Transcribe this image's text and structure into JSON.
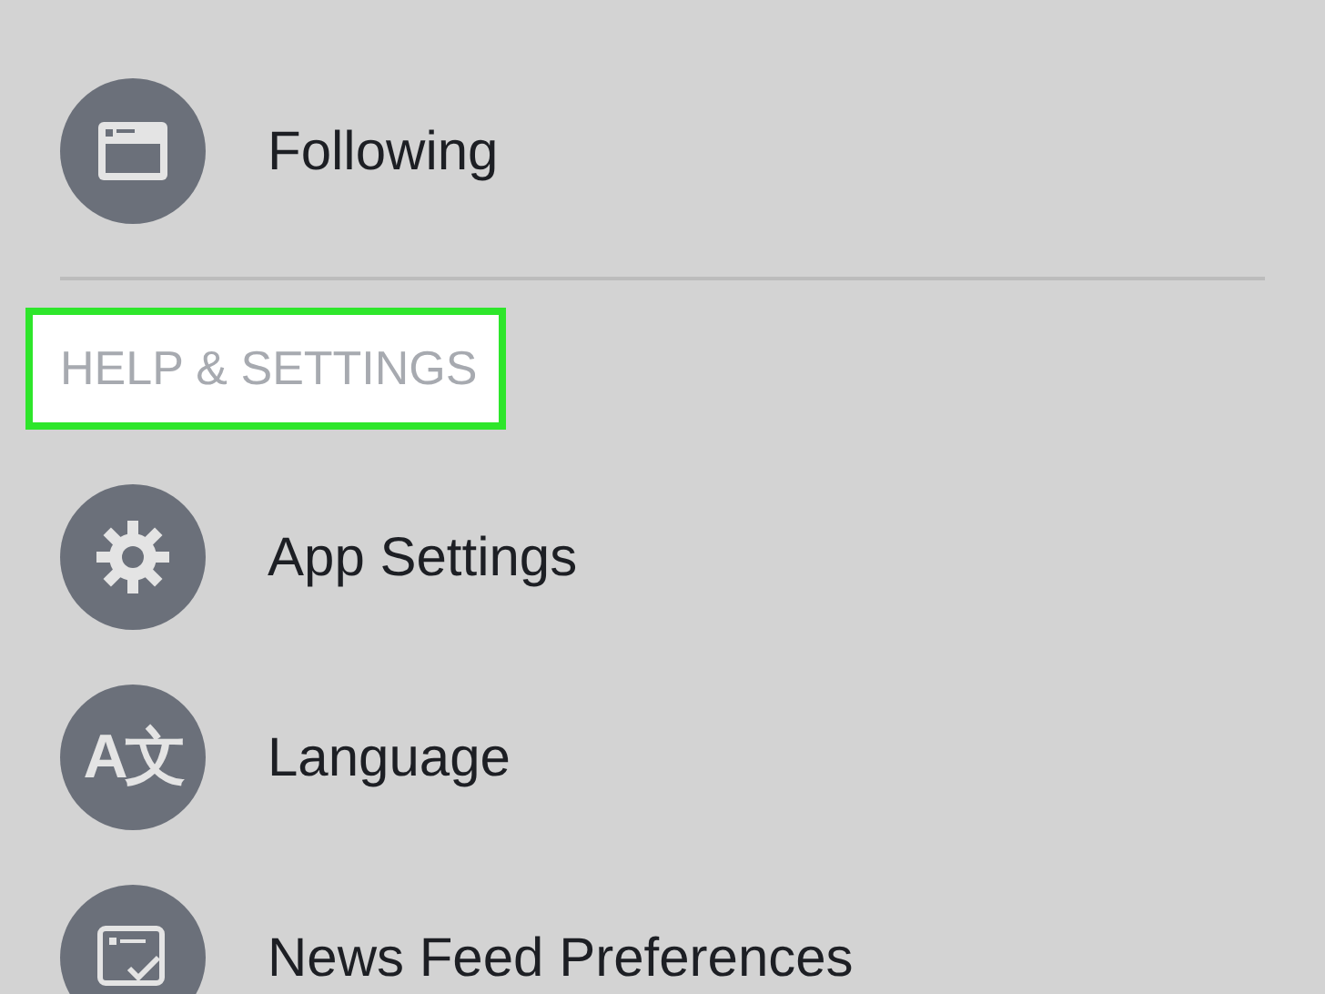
{
  "menu": {
    "items": [
      {
        "kind": "page",
        "label": "Following"
      },
      {
        "kind": "header",
        "label": "HELP & SETTINGS",
        "highlighted": true
      },
      {
        "kind": "gear",
        "label": "App Settings"
      },
      {
        "kind": "glyph",
        "label": "Language",
        "icon_text": "A文"
      },
      {
        "kind": "checklist",
        "label": "News Feed Preferences"
      }
    ]
  }
}
